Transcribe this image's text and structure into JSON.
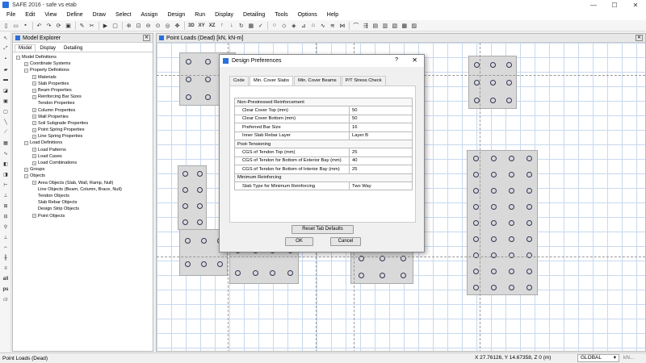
{
  "window": {
    "title": "SAFE 2016 - safe vs etab",
    "minimize": "—",
    "maximize": "☐",
    "close": "✕"
  },
  "menu": [
    "File",
    "Edit",
    "View",
    "Define",
    "Draw",
    "Select",
    "Assign",
    "Design",
    "Run",
    "Display",
    "Detailing",
    "Tools",
    "Options",
    "Help"
  ],
  "toolbar": {
    "view_3d": "3D",
    "view_xy": "XY",
    "view_xz": "XZ"
  },
  "left_toolbar": {
    "all": "all",
    "ps": "ps",
    "clr": "clr"
  },
  "explorer": {
    "title": "Model Explorer",
    "tabs": [
      "Model",
      "Display",
      "Detailing"
    ],
    "tree": [
      {
        "level": 0,
        "toggle": "−",
        "label": "Model Definitions"
      },
      {
        "level": 1,
        "toggle": "+",
        "label": "Coordinate Systems"
      },
      {
        "level": 1,
        "toggle": "−",
        "label": "Property Definitions"
      },
      {
        "level": 2,
        "toggle": "+",
        "label": "Materials"
      },
      {
        "level": 2,
        "toggle": "+",
        "label": "Slab Properties"
      },
      {
        "level": 2,
        "toggle": "+",
        "label": "Beam Properties"
      },
      {
        "level": 2,
        "toggle": "+",
        "label": "Reinforcing Bar Sizes"
      },
      {
        "level": 2,
        "toggle": "",
        "label": "Tendon Properties"
      },
      {
        "level": 2,
        "toggle": "+",
        "label": "Column Properties"
      },
      {
        "level": 2,
        "toggle": "+",
        "label": "Wall Properties"
      },
      {
        "level": 2,
        "toggle": "+",
        "label": "Soil Subgrade Properties"
      },
      {
        "level": 2,
        "toggle": "+",
        "label": "Point Spring Properties"
      },
      {
        "level": 2,
        "toggle": "+",
        "label": "Line Spring Properties"
      },
      {
        "level": 1,
        "toggle": "−",
        "label": "Load Definitions"
      },
      {
        "level": 2,
        "toggle": "+",
        "label": "Load Patterns"
      },
      {
        "level": 2,
        "toggle": "+",
        "label": "Load Cases"
      },
      {
        "level": 2,
        "toggle": "+",
        "label": "Load Combinations"
      },
      {
        "level": 1,
        "toggle": "+",
        "label": "Groups"
      },
      {
        "level": 1,
        "toggle": "−",
        "label": "Objects"
      },
      {
        "level": 2,
        "toggle": "+",
        "label": "Area Objects (Slab, Wall, Ramp, Null)"
      },
      {
        "level": 2,
        "toggle": "",
        "label": "Line Objects (Beam, Column, Brace, Null)"
      },
      {
        "level": 2,
        "toggle": "",
        "label": "Tendon Objects"
      },
      {
        "level": 2,
        "toggle": "",
        "label": "Slab Rebar Objects"
      },
      {
        "level": 2,
        "toggle": "",
        "label": "Design Strip Objects"
      },
      {
        "level": 2,
        "toggle": "+",
        "label": "Point Objects"
      }
    ]
  },
  "canvas": {
    "title": "Point Loads (Dead)  [kN, kN-m]"
  },
  "dialog": {
    "title": "Design Preferences",
    "help": "?",
    "close": "✕",
    "tabs": [
      "Code",
      "Min. Cover Slabs",
      "Min. Cover Beams",
      "P/T Stress Check"
    ],
    "active_tab": 1,
    "rows": [
      {
        "type": "section",
        "label": "Non-Prestressed Reinforcement"
      },
      {
        "type": "row",
        "label": "Clear Cover Top  (mm)",
        "value": "50"
      },
      {
        "type": "row",
        "label": "Clear Cover Bottom  (mm)",
        "value": "50"
      },
      {
        "type": "row",
        "label": "Preferred Bar Size",
        "value": "16"
      },
      {
        "type": "row",
        "label": "Inner Slab Rebar Layer",
        "value": "Layer B"
      },
      {
        "type": "section",
        "label": "Post-Tensioning"
      },
      {
        "type": "row",
        "label": "CGS of Tendon Top  (mm)",
        "value": "25"
      },
      {
        "type": "row",
        "label": "CGS of Tendon for Bottom of Exterior Bay  (mm)",
        "value": "40"
      },
      {
        "type": "row",
        "label": "CGS of Tendon for Bottom of Interior Bay  (mm)",
        "value": "25"
      },
      {
        "type": "section",
        "label": "Minimum Reinforcing"
      },
      {
        "type": "row",
        "label": "Slab Type for Minimum Reinforcing",
        "value": "Two Way"
      }
    ],
    "reset_label": "Reset Tab Defaults",
    "ok_label": "OK",
    "cancel_label": "Cancel"
  },
  "status": {
    "left": "Point Loads (Dead)",
    "coords": "X 27.76126,  Y 14.67358,  Z 0  (m)",
    "coord_system": "GLOBAL",
    "units": "kN..."
  }
}
